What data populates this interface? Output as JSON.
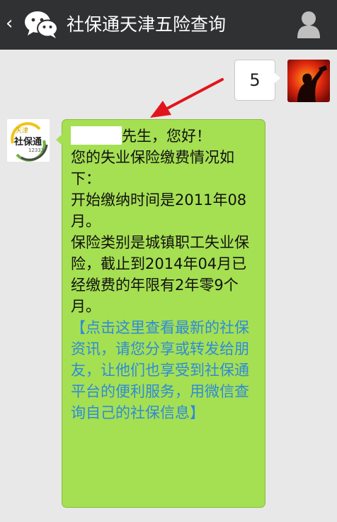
{
  "header": {
    "back_glyph": "‹",
    "title": "社保通天津五险查询",
    "background": "#2f3133"
  },
  "conversation": {
    "user_message": "5",
    "bot_avatar_text": {
      "line1": "天津",
      "line2": "社保通",
      "line3": "12333"
    },
    "bot_message": {
      "greeting_suffix": "先生，您好！",
      "line_intro": "您的失业保险缴费情况如下：",
      "line_start": "开始缴纳时间是2011年08月。",
      "line_type": "保险类别是城镇职工失业保险，截止到2014年04月已经缴费的年限有2年零9个月。",
      "link_text": "【点击这里查看最新的社保资讯，请您分享或转发给朋友，让他们也享受到社保通平台的便利服务，用微信查询自己的社保信息】"
    },
    "colors": {
      "chat_background": "#e8e8e8",
      "bot_bubble": "#a5df52",
      "link": "#2f8bd8",
      "annotation_arrow": "#e2141b"
    }
  }
}
